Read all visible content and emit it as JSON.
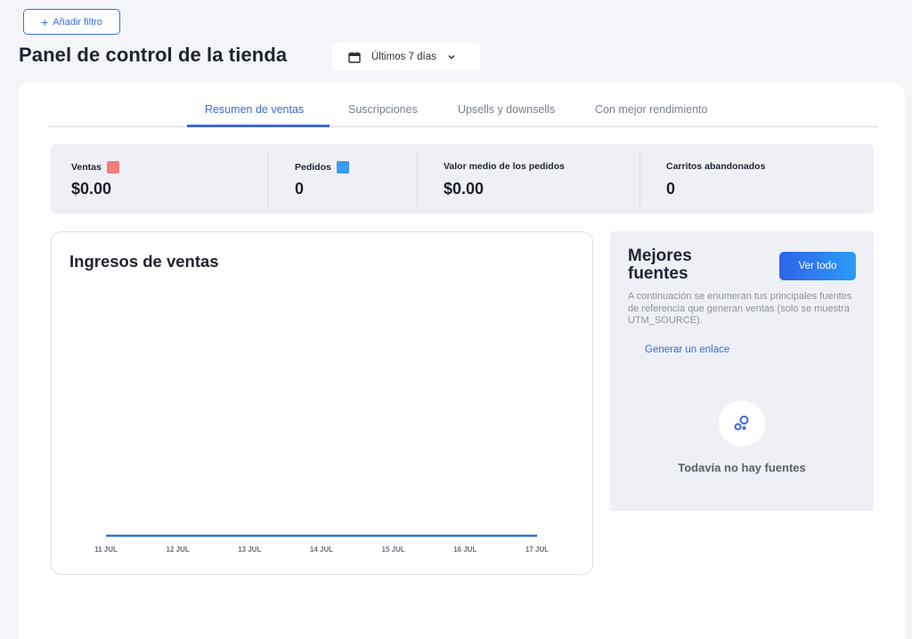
{
  "filters": {
    "add_label": "Añadir filtro"
  },
  "header": {
    "title": "Panel de control de la tienda",
    "date_range": "Últimos 7 días"
  },
  "tabs": [
    {
      "label": "Resumen de ventas",
      "active": true
    },
    {
      "label": "Suscripciones",
      "active": false
    },
    {
      "label": "Upsells y downsells",
      "active": false
    },
    {
      "label": "Con mejor rendimiento",
      "active": false
    }
  ],
  "stats": [
    {
      "label": "Ventas",
      "value": "$0.00",
      "swatch": "#f07d7d"
    },
    {
      "label": "Pedidos",
      "value": "0",
      "swatch": "#3a9cf2"
    },
    {
      "label": "Valor medio de los pedidos",
      "value": "$0.00"
    },
    {
      "label": "Carritos abandonados",
      "value": "0"
    }
  ],
  "chart": {
    "title": "Ingresos de ventas"
  },
  "chart_data": {
    "type": "line",
    "title": "Ingresos de ventas",
    "x": [
      "11 JUL",
      "12 JUL",
      "13 JUL",
      "14 JUL",
      "15 JUL",
      "16 JUL",
      "17 JUL"
    ],
    "series": [
      {
        "values": [
          0,
          0,
          0,
          0,
          0,
          0,
          0
        ],
        "color": "#2b74d9"
      }
    ],
    "grid": false
  },
  "sources": {
    "title": "Mejores fuentes",
    "view_all": "Ver todo",
    "description": "A continuación se enumeran tus principales fuentes de referencia que generan ventas (solo se muestra UTM_SOURCE).",
    "generate_link": "Generar un enlace",
    "empty_text": "Todavía no hay fuentes"
  },
  "colors": {
    "accent": "#3d68dd",
    "page_bg": "#f4f5f9"
  }
}
